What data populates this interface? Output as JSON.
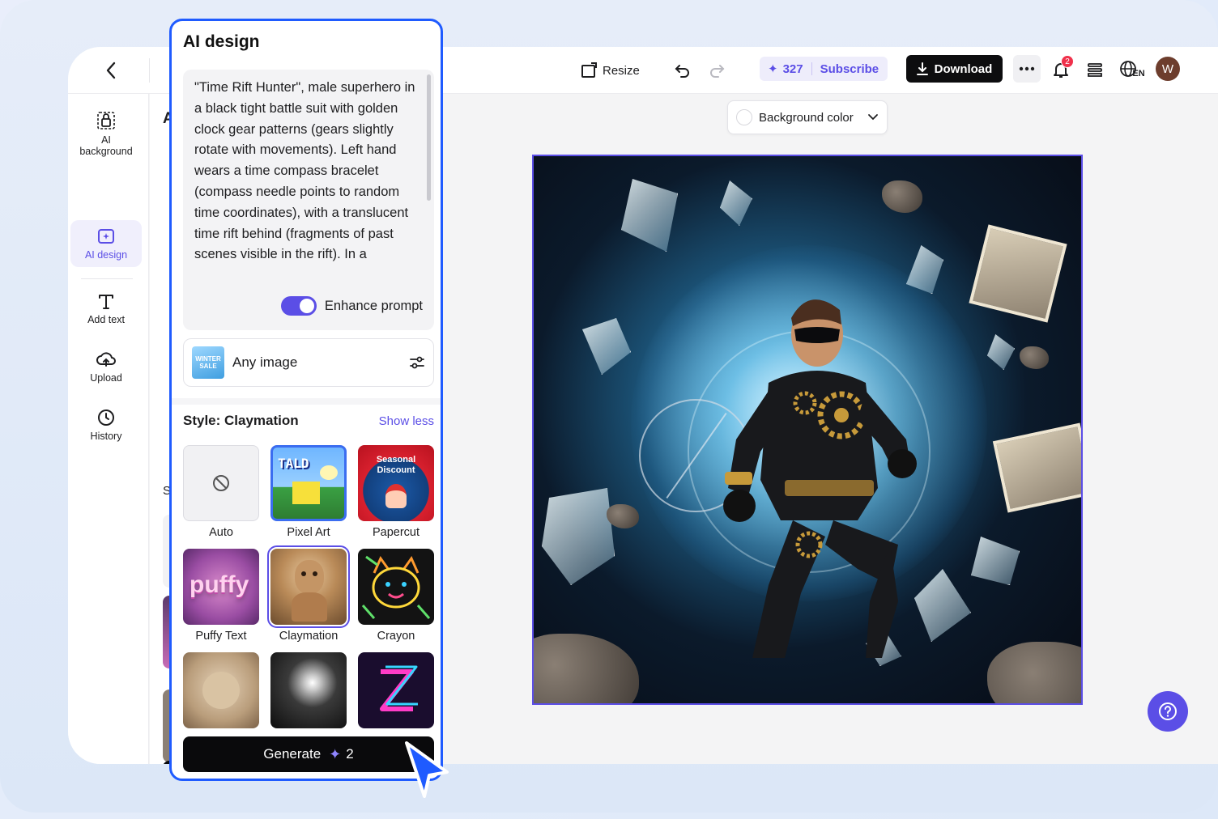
{
  "topbar": {
    "resize_label": "Resize",
    "credits": "327",
    "subscribe_label": "Subscribe",
    "download_label": "Download",
    "notification_count": "2",
    "language_label": "EN",
    "avatar_initial": "W"
  },
  "sidebar": {
    "items": [
      {
        "label": "AI background",
        "icon": "lock-frame-icon"
      },
      {
        "label": "AI design",
        "icon": "ai-design-icon"
      },
      {
        "label": "Add text",
        "icon": "text-icon"
      },
      {
        "label": "Upload",
        "icon": "upload-cloud-icon"
      },
      {
        "label": "History",
        "icon": "clock-icon"
      }
    ],
    "active_index": 1
  },
  "hidden_panel": {
    "peek_title_char": "A",
    "peek_section_char": "S"
  },
  "canvas": {
    "background_color_label": "Background color"
  },
  "ai_panel": {
    "title": "AI design",
    "prompt": "\"Time Rift Hunter\", male superhero in a black tight battle suit with golden clock gear patterns (gears slightly rotate with movements). Left hand wears a time compass bracelet (compass needle points to random time coordinates), with a translucent time rift behind (fragments of past scenes visible in the rift). In a",
    "enhance_label": "Enhance prompt",
    "enhance_on": true,
    "image_type_label": "Any image",
    "image_thumb_text": "WINTER SALE",
    "style_header": "Style: Claymation",
    "show_less_label": "Show less",
    "styles": [
      {
        "label": "Auto",
        "thumb_text": ""
      },
      {
        "label": "Pixel Art",
        "thumb_text": "TALD"
      },
      {
        "label": "Papercut",
        "thumb_text": "Seasonal Discount"
      },
      {
        "label": "Puffy Text",
        "thumb_text": "puffy"
      },
      {
        "label": "Claymation",
        "thumb_text": ""
      },
      {
        "label": "Crayon",
        "thumb_text": ""
      },
      {
        "label": "",
        "thumb_text": ""
      },
      {
        "label": "",
        "thumb_text": ""
      },
      {
        "label": "",
        "thumb_text": ""
      }
    ],
    "selected_style_index": 4,
    "generate_label": "Generate",
    "generate_cost": "2"
  },
  "colors": {
    "accent": "#5b4ee6",
    "panel_border": "#1f5bff",
    "dark_button": "#0d0d0f"
  }
}
